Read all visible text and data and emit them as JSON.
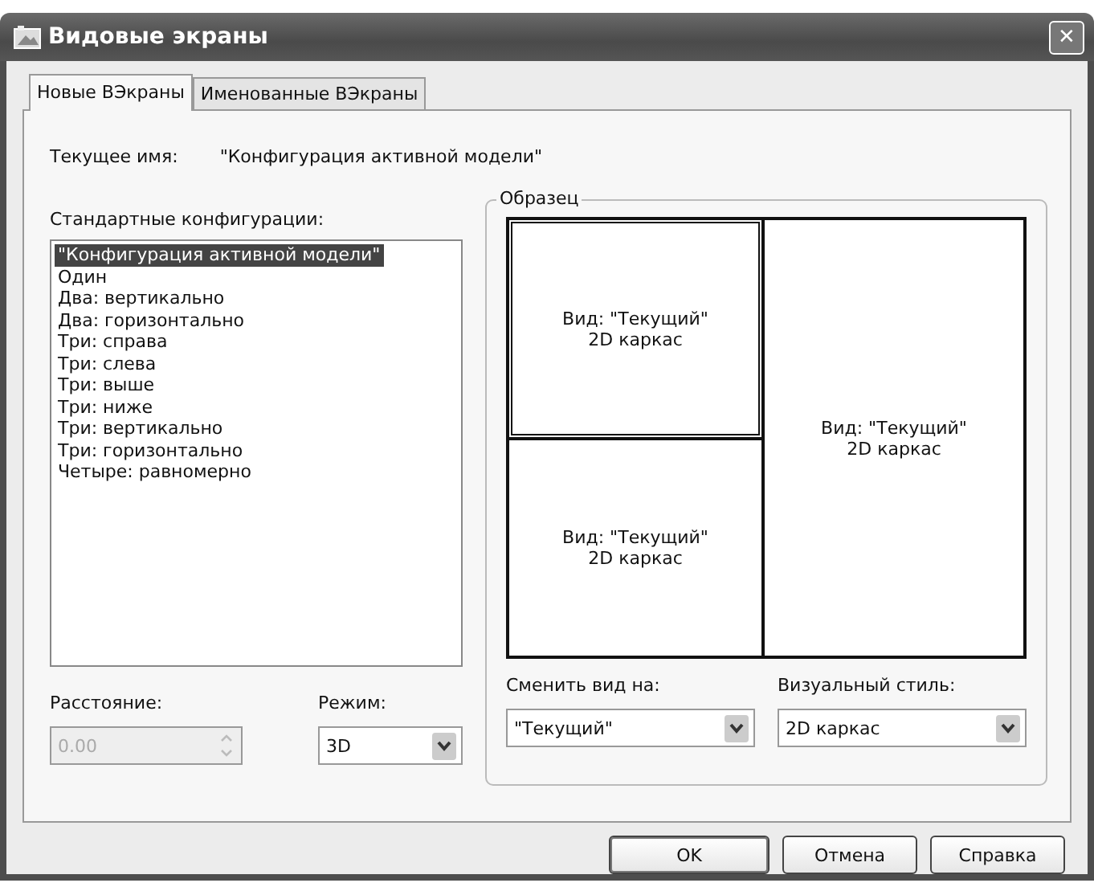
{
  "window": {
    "title": "Видовые экраны",
    "close": "✕"
  },
  "tabs": [
    {
      "label": "Новые ВЭкраны",
      "selected": true
    },
    {
      "label": "Именованные ВЭкраны",
      "selected": false
    }
  ],
  "current_name": {
    "label": "Текущее имя:",
    "value": "\"Конфигурация активной модели\""
  },
  "configs": {
    "label": "Стандартные конфигурации:",
    "items": [
      {
        "label": "\"Конфигурация активной модели\"",
        "selected": true
      },
      {
        "label": "Один",
        "selected": false
      },
      {
        "label": "Два: вертикально",
        "selected": false
      },
      {
        "label": "Два: горизонтально",
        "selected": false
      },
      {
        "label": "Три: справа",
        "selected": false
      },
      {
        "label": "Три: слева",
        "selected": false
      },
      {
        "label": "Три: выше",
        "selected": false
      },
      {
        "label": "Три: ниже",
        "selected": false
      },
      {
        "label": "Три: вертикально",
        "selected": false
      },
      {
        "label": "Три: горизонтально",
        "selected": false
      },
      {
        "label": "Четыре: равномерно",
        "selected": false
      }
    ]
  },
  "preview": {
    "label": "Образец",
    "viewports": [
      {
        "view": "Вид: \"Текущий\"",
        "style": "2D каркас",
        "selected": true
      },
      {
        "view": "Вид: \"Текущий\"",
        "style": "2D каркас",
        "selected": false
      },
      {
        "view": "Вид: \"Текущий\"",
        "style": "2D каркас",
        "selected": false
      }
    ]
  },
  "distance": {
    "label": "Расстояние:",
    "value": "0.00",
    "disabled": true
  },
  "mode": {
    "label": "Режим:",
    "value": "3D"
  },
  "change_view": {
    "label": "Сменить вид на:",
    "value": "\"Текущий\""
  },
  "visual_style": {
    "label": "Визуальный стиль:",
    "value": "2D каркас"
  },
  "buttons": [
    {
      "label": "OK",
      "default": true
    },
    {
      "label": "Отмена",
      "default": false
    },
    {
      "label": "Справка",
      "default": false
    }
  ]
}
